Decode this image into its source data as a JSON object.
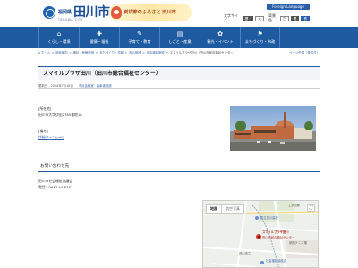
{
  "header": {
    "pref": "福岡県",
    "city": "田川市",
    "roman": "TAGAWA CITY",
    "tagline": "炭坑節のふるさと 田川市",
    "foreign_button": "Foreign Language",
    "text_size_label": "文字サイズ",
    "text_size_standard": "標準",
    "text_size_large": "大",
    "bg_color_label": "背景色",
    "bg_color_options": [
      "白",
      "黒",
      "青"
    ],
    "search_button": "検索"
  },
  "nav": [
    {
      "label": "くらし・環境",
      "icon": "⌂"
    },
    {
      "label": "健康・福祉",
      "icon": "✚"
    },
    {
      "label": "子育て・教育",
      "icon": "✎"
    },
    {
      "label": "しごと・産業",
      "icon": "▤"
    },
    {
      "label": "観光・イベント",
      "icon": "✿"
    },
    {
      "label": "まちづくり・市政",
      "icon": "⚑"
    }
  ],
  "breadcrumb": {
    "items": [
      "ホーム",
      "施設案内",
      "福祉・医療施設",
      "まちづくり・市政",
      "市の施設",
      "社会福祉施設",
      "スマイルプラザ田川（田川市総合福祉センター）"
    ],
    "right_link": "ページ先頭（条件付）"
  },
  "page": {
    "title": "スマイルプラザ田川（田川市総合福祉センター）",
    "updated": "更新日：2024年7月18日",
    "tags": [
      "市民会議室",
      "高齢者施設"
    ]
  },
  "content": {
    "address_heading": "[所在地]",
    "address": "田川市大字伊田2765番地18",
    "notes_heading": "[備考]",
    "notes_link": "詳細ページ(pdf)"
  },
  "inquiry": {
    "heading": "お問い合わせ先",
    "org": "田川市社会福祉協議会",
    "tel": "電話：0947-44-8757"
  },
  "map": {
    "tabs": [
      "地図",
      "航空写真"
    ],
    "labels": {
      "l1": "上伊田駅",
      "l2": "スマイルプラザ田川",
      "l3": "田川市総合福祉センター",
      "l4": "田川市立",
      "l5": "県立田川高校",
      "l6": "伊田テニス場",
      "l7": "社会福祉協議会"
    }
  },
  "colors": {
    "brand_blue": "#1e5aa0",
    "link": "#3462a5",
    "tagline": "#b04a1c"
  }
}
